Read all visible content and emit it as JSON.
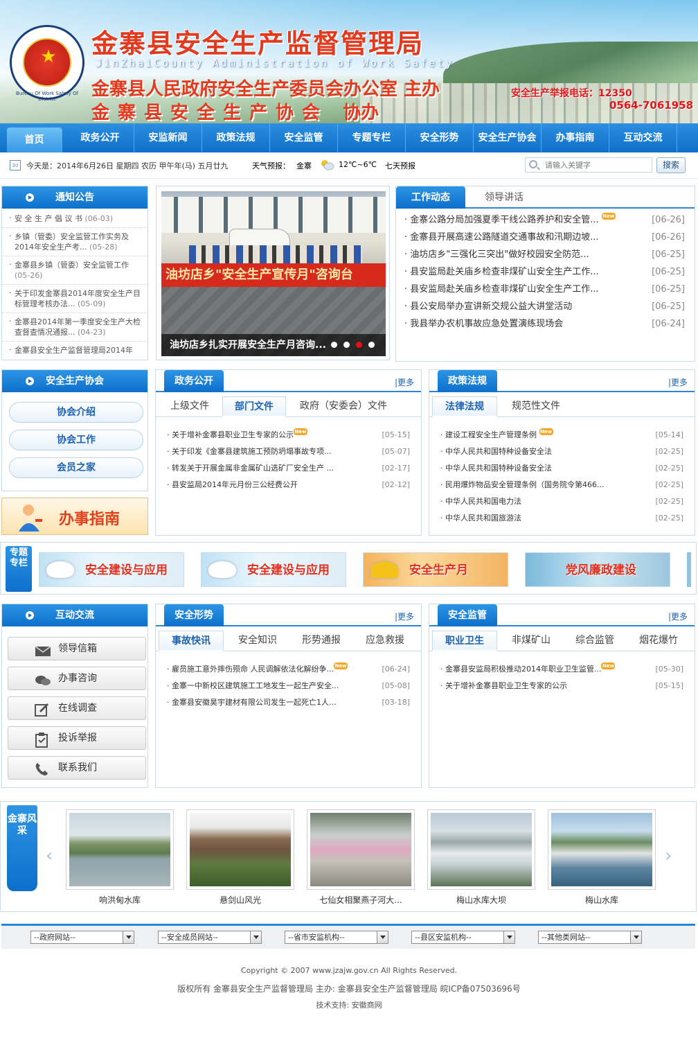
{
  "header": {
    "title_cn": "金寨县安全生产监督管理局",
    "title_en": "JinZhaiCounty Administration of Work Safety",
    "sponsor_line1": "金寨县人民政府安全生产委员会办公室 主办",
    "sponsor_line2_org": "金寨县安全生产协会",
    "sponsor_line2_role": "协办",
    "hotline_label": "安全生产举报电话：12350",
    "hotline_number": "0564-7061958",
    "emblem_text": "Bureau Of Work Safety Of District"
  },
  "nav": [
    "首页",
    "政务公开",
    "安监新闻",
    "政策法规",
    "安全监管",
    "专题专栏",
    "安全形势",
    "安全生产协会",
    "办事指南",
    "互动交流"
  ],
  "infobar": {
    "calendar_day": "30",
    "date": "今天是：2014年6月26日 星期四 农历 甲午年(马) 五月廿九",
    "weather_label": "天气预报：",
    "city": "金寨",
    "temp": "12℃~6℃",
    "forecast": "七天预报",
    "search_placeholder": "请输入关键字",
    "search_button": "搜索"
  },
  "notice": {
    "title": "通知公告",
    "items": [
      {
        "t": "安 全 生 产 倡 议 书",
        "d": "(06-03)"
      },
      {
        "t": "乡镇（管委）安全监管工作实务及2014年安全生产考...",
        "d": "(05-28)"
      },
      {
        "t": "金寨县乡镇（管委）安全监管工作",
        "d": "(05-26)"
      },
      {
        "t": "关于印发金寨县2014年度安全生产目标管理考核办法...",
        "d": "(05-09)"
      },
      {
        "t": "金寨县2014年第一季度安全生产大检查督查情况通报...",
        "d": "(04-23)"
      },
      {
        "t": "金寨县安全生产监督管理局2014年",
        "d": ""
      }
    ]
  },
  "slideshow": {
    "banner_text": "油坊店乡\"安全生产宣传月\"咨询台",
    "caption": "油坊店乡扎实开展安全生产月咨询...",
    "dots": 4,
    "active_dot": 3
  },
  "work": {
    "tab_active": "工作动态",
    "tab_other": "领导讲话",
    "items": [
      {
        "t": "金寨公路分局加强夏季干线公路养护和安全管...",
        "d": "[06-26]",
        "new": true
      },
      {
        "t": "金寨县开展高速公路隧道交通事故和汛期边坡...",
        "d": "[06-26]",
        "new": false
      },
      {
        "t": "油坊店乡\"三强化三突出\"做好校园安全防范...",
        "d": "[06-25]",
        "new": false
      },
      {
        "t": "县安监局赴关庙乡检查非煤矿山安全生产工作...",
        "d": "[06-25]",
        "new": false
      },
      {
        "t": "县安监局赴关庙乡检查非煤矿山安全生产工作...",
        "d": "[06-25]",
        "new": false
      },
      {
        "t": "县公安局举办宣讲新交规公益大讲堂活动",
        "d": "[06-25]",
        "new": false
      },
      {
        "t": "我县举办农机事故应急处置演练现场会",
        "d": "[06-24]",
        "new": false
      }
    ]
  },
  "association": {
    "title": "安全生产协会",
    "buttons": [
      "协会介绍",
      "协会工作",
      "会员之家"
    ]
  },
  "guide_banner": "办事指南",
  "new_badge": "New",
  "more_label": "|更多",
  "gov": {
    "title": "政务公开",
    "subtabs": [
      "上级文件",
      "部门文件",
      "政府（安委会）文件"
    ],
    "items": [
      {
        "t": "关于增补金寨县职业卫生专家的公示",
        "d": "[05-15]",
        "new": true
      },
      {
        "t": "关于印发《金寨县建筑施工预防坍塌事故专项...",
        "d": "[05-07]",
        "new": false
      },
      {
        "t": "转发关于开展金属非金属矿山选矿厂安全生产 ...",
        "d": "[02-17]",
        "new": false
      },
      {
        "t": "县安监局2014年元月份三公经费公开",
        "d": "[02-12]",
        "new": false
      }
    ]
  },
  "policy": {
    "title": "政策法规",
    "subtabs": [
      "法律法规",
      "规范性文件"
    ],
    "items": [
      {
        "t": "建设工程安全生产管理条例",
        "d": "[05-14]",
        "new": true
      },
      {
        "t": "中华人民共和国特种设备安全法",
        "d": "[02-25]",
        "new": false
      },
      {
        "t": "中华人民共和国特种设备安全法",
        "d": "[02-25]",
        "new": false
      },
      {
        "t": "民用爆炸物品安全管理条例（国务院令第466...",
        "d": "[02-25]",
        "new": false
      },
      {
        "t": "中华人民共和国电力法",
        "d": "[02-25]",
        "new": false
      },
      {
        "t": "中华人民共和国旅游法",
        "d": "[02-25]",
        "new": false
      }
    ]
  },
  "special": {
    "label": "专题专栏",
    "items": [
      "安全建设与应用",
      "安全建设与应用",
      "安全生产月",
      "党风廉政建设"
    ]
  },
  "interactive": {
    "title": "互动交流",
    "buttons": [
      "领导信箱",
      "办事咨询",
      "在线调查",
      "投诉举报",
      "联系我们"
    ]
  },
  "situation": {
    "title": "安全形势",
    "subtabs": [
      "事故快讯",
      "安全知识",
      "形势通报",
      "应急救援"
    ],
    "items": [
      {
        "t": "雇员施工意外摔伤殒命 人民调解依法化解纷争...",
        "d": "[06-24]",
        "new": true
      },
      {
        "t": "金寨一中新校区建筑施工工地发生一起生产安全...",
        "d": "[05-08]",
        "new": false
      },
      {
        "t": "金寨县安徽昊宇建材有限公司发生一起死亡1人...",
        "d": "[03-18]",
        "new": false
      }
    ]
  },
  "supervision": {
    "title": "安全监管",
    "subtabs": [
      "职业卫生",
      "非煤矿山",
      "综合监管",
      "烟花爆竹"
    ],
    "items": [
      {
        "t": "金寨县安监局积极推动2014年职业卫生监管...",
        "d": "[05-30]",
        "new": true
      },
      {
        "t": "关于增补金寨县职业卫生专家的公示",
        "d": "[05-15]",
        "new": false
      }
    ]
  },
  "gallery": {
    "label": "金寨风采",
    "items": [
      "响洪甸水库",
      "悬剑山风光",
      "七仙女相聚燕子河大...",
      "梅山水库大坝",
      "梅山水库"
    ]
  },
  "links": [
    "--政府网站--",
    "--安全成员网站--",
    "--省市安监机构--",
    "--县区安监机构--",
    "--其他类网站--"
  ],
  "footer": {
    "copyright": "Copyright © 2007 www.jzajw.gov.cn All Rights Reserved.",
    "rights": "版权所有 金寨县安全生产监督管理局 主办: 金寨县安全生产监督管理局 皖ICP备07503696号",
    "support": "技术支持: 安徽商网"
  }
}
